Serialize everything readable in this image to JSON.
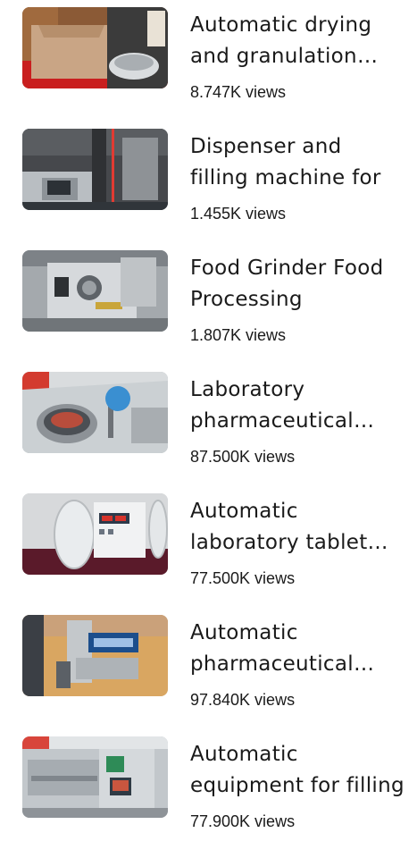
{
  "videos": [
    {
      "title": "Automatic drying and granulation machine",
      "views": "8.747K views",
      "thumbnail_icon": "drying-granulation-machine-thumbnail",
      "colors": {
        "bg": "#7a4b2a",
        "accent": "#d8cfc2",
        "floor": "#c91f1f"
      }
    },
    {
      "title": "Dispenser and filling machine for",
      "views": "1.455K views",
      "thumbnail_icon": "dispenser-filling-machine-thumbnail",
      "colors": {
        "bg": "#3e4044",
        "accent": "#c7cbcf",
        "floor": "#e23b33"
      }
    },
    {
      "title": "Food Grinder Food Processing",
      "views": "1.807K views",
      "thumbnail_icon": "food-grinder-thumbnail",
      "colors": {
        "bg": "#9ea3a7",
        "accent": "#e4e6e8",
        "floor": "#6f7377"
      }
    },
    {
      "title": "Laboratory pharmaceutical machine",
      "views": "87.500K views",
      "thumbnail_icon": "laboratory-machine-thumbnail",
      "colors": {
        "bg": "#b7bcc0",
        "accent": "#3a8fd1",
        "floor": "#d33b2f"
      }
    },
    {
      "title": "Automatic laboratory tablet tester",
      "views": "77.500K views",
      "thumbnail_icon": "tablet-tester-thumbnail",
      "colors": {
        "bg": "#d4d6d8",
        "accent": "#2d3a4a",
        "floor": "#5a1a2a"
      }
    },
    {
      "title": "Automatic pharmaceutical packing",
      "views": "97.840K views",
      "thumbnail_icon": "pharmaceutical-packing-thumbnail",
      "colors": {
        "bg": "#d9a661",
        "accent": "#1c4e8c",
        "floor": "#c08a45"
      }
    },
    {
      "title": "Automatic equipment for filling",
      "views": "77.900K views",
      "thumbnail_icon": "filling-equipment-thumbnail",
      "colors": {
        "bg": "#b9bfc4",
        "accent": "#2e8b57",
        "floor": "#e0e3e5"
      }
    }
  ]
}
